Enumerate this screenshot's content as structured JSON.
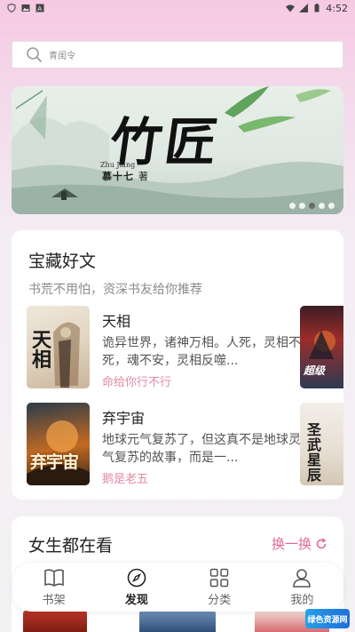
{
  "status_bar": {
    "time": "4:52"
  },
  "search": {
    "placeholder": "青闺令"
  },
  "banner": {
    "title": "竹匠",
    "author_pinyin": "Zhu Jiang",
    "author": "慕十七",
    "author_suffix": "著",
    "dots_total": 5,
    "dots_active_index": 2
  },
  "section_treasure": {
    "title": "宝藏好文",
    "subtitle": "书荒不用怕，资深书友给你推荐",
    "books": [
      {
        "name": "天相",
        "desc": "诡异世界，诸神万相。人死，灵相不死，魂不安，灵相反噬...",
        "author": "命给你行不行",
        "cover_text": "天相"
      },
      {
        "name": "弃宇宙",
        "desc": "地球元气复苏了，但这真不是地球灵气复苏的故事，而是一...",
        "author": "鹅是老五",
        "cover_text": "弃宇宙"
      }
    ],
    "side_books": [
      {
        "cover_text": "超级"
      },
      {
        "cover_text": "圣武星辰"
      }
    ]
  },
  "section_girls": {
    "title": "女生都在看",
    "refresh_label": "换一换"
  },
  "bottom_nav": {
    "items": [
      {
        "label": "书架",
        "icon": "book-icon"
      },
      {
        "label": "发现",
        "icon": "compass-icon"
      },
      {
        "label": "分类",
        "icon": "grid-icon"
      },
      {
        "label": "我的",
        "icon": "user-icon"
      }
    ],
    "active_index": 1
  },
  "watermark": {
    "text": "绿色资源网"
  },
  "colors": {
    "accent": "#e26a92",
    "author": "#e28aa2"
  }
}
